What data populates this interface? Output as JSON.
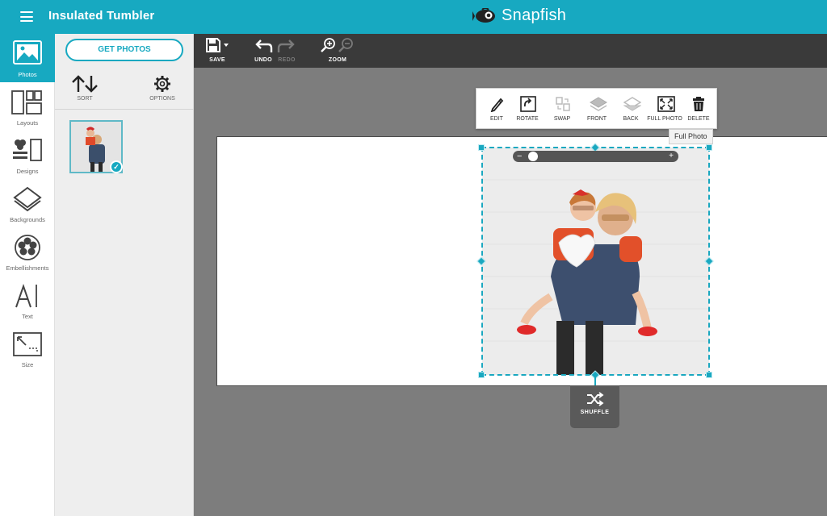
{
  "header": {
    "title": "Insulated Tumbler",
    "brand": "Snapfish",
    "menu_icon": "hamburger-menu-icon",
    "brand_color": "#17a9c1"
  },
  "rail": {
    "items": [
      {
        "label": "Photos",
        "icon": "photos-icon",
        "active": true
      },
      {
        "label": "Layouts",
        "icon": "layouts-icon"
      },
      {
        "label": "Designs",
        "icon": "designs-icon"
      },
      {
        "label": "Backgrounds",
        "icon": "backgrounds-icon"
      },
      {
        "label": "Embellishments",
        "icon": "embellishments-icon"
      },
      {
        "label": "Text",
        "icon": "text-icon"
      },
      {
        "label": "Size",
        "icon": "size-icon"
      }
    ]
  },
  "panel": {
    "get_photos": "GET PHOTOS",
    "sort": "SORT",
    "options": "OPTIONS"
  },
  "toolbar": {
    "save": "SAVE",
    "undo": "UNDO",
    "redo": "REDO",
    "zoom": "ZOOM"
  },
  "photo_tools": {
    "edit": "EDIT",
    "rotate": "ROTATE",
    "swap": "SWAP",
    "front": "FRONT",
    "back": "BACK",
    "full_photo": "FULL PHOTO",
    "delete": "DELETE"
  },
  "tooltip": "Full Photo",
  "shuffle": "SHUFFLE",
  "zoom_slider": {
    "minus": "−",
    "plus": "+"
  }
}
